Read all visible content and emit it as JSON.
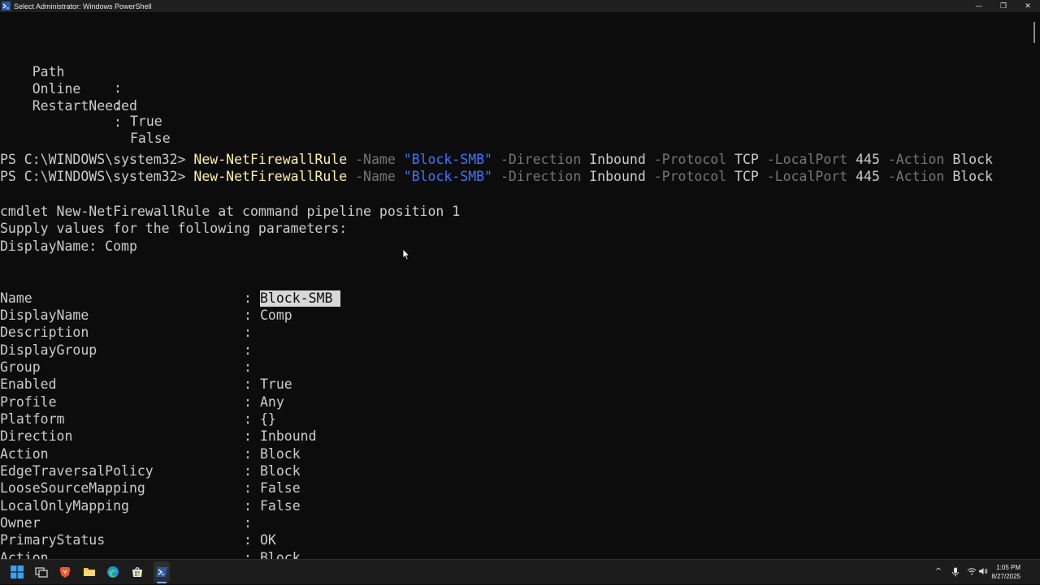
{
  "window": {
    "title": "Select Administrator: Windows PowerShell",
    "controls": {
      "minimize": "—",
      "maximize": "❐",
      "close": "✕"
    }
  },
  "console": {
    "top_lines": [
      {
        "key": "Path",
        "value": ""
      },
      {
        "key": "Online",
        "value": "True"
      },
      {
        "key": "RestartNeeded",
        "value": "False"
      }
    ],
    "commands": [
      {
        "prompt": "PS C:\\WINDOWS\\system32>",
        "cmdlet": "New-NetFirewallRule",
        "p1": "-Name",
        "v1": "\"Block-SMB\"",
        "p2": "-Direction",
        "v2": "Inbound",
        "p3": "-Protocol",
        "v3": "TCP",
        "p4": "-LocalPort",
        "v4": "445",
        "p5": "-Action",
        "v5": "Block"
      },
      {
        "prompt": "PS C:\\WINDOWS\\system32>",
        "cmdlet": "New-NetFirewallRule",
        "p1": "-Name",
        "v1": "\"Block-SMB\"",
        "p2": "-Direction",
        "v2": "Inbound",
        "p3": "-Protocol",
        "v3": "TCP",
        "p4": "-LocalPort",
        "v4": "445",
        "p5": "-Action",
        "v5": "Block"
      }
    ],
    "messages": [
      "cmdlet New-NetFirewallRule at command pipeline position 1",
      "Supply values for the following parameters:",
      "DisplayName: Comp"
    ],
    "separator": ":",
    "properties": [
      {
        "key": "Name",
        "value": "Block-SMB",
        "selected": true
      },
      {
        "key": "DisplayName",
        "value": "Comp"
      },
      {
        "key": "Description",
        "value": ""
      },
      {
        "key": "DisplayGroup",
        "value": ""
      },
      {
        "key": "Group",
        "value": ""
      },
      {
        "key": "Enabled",
        "value": "True"
      },
      {
        "key": "Profile",
        "value": "Any"
      },
      {
        "key": "Platform",
        "value": "{}"
      },
      {
        "key": "Direction",
        "value": "Inbound"
      },
      {
        "key": "Action",
        "value": "Block"
      },
      {
        "key": "EdgeTraversalPolicy",
        "value": "Block"
      },
      {
        "key": "LooseSourceMapping",
        "value": "False"
      },
      {
        "key": "LocalOnlyMapping",
        "value": "False"
      },
      {
        "key": "Owner",
        "value": ""
      },
      {
        "key": "PrimaryStatus",
        "value": "OK"
      },
      {
        "key": "Action",
        "value": "Block"
      }
    ]
  },
  "taskbar": {
    "icons": [
      "windows-start-icon",
      "task-view-icon",
      "brave-browser-icon",
      "file-explorer-icon",
      "edge-browser-icon",
      "microsoft-store-icon",
      "powershell-icon"
    ],
    "tray": {
      "chevron": "^",
      "mic": "🎙",
      "wifi": "wifi-icon",
      "volume": "volume-icon"
    },
    "clock": {
      "time": "1:05 PM",
      "date": "8/27/2025"
    }
  },
  "colors": {
    "background": "#0c0c0c",
    "text": "#cccccc",
    "cmdlet": "#f9f1a5",
    "parameter": "#767676",
    "string": "#3b78ff",
    "selection": "#d8d8d8"
  }
}
